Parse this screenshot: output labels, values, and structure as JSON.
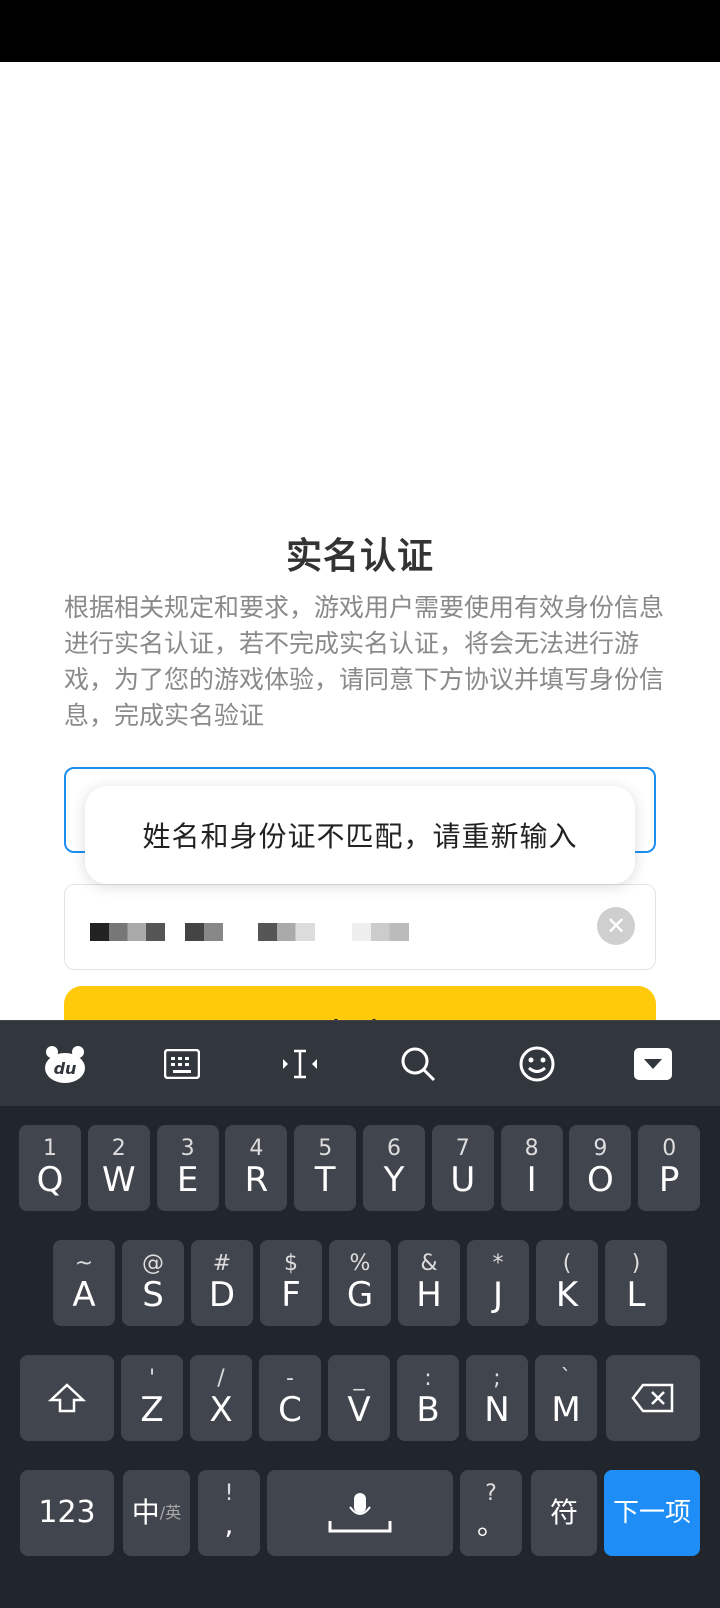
{
  "page": {
    "title": "实名认证",
    "description": "根据相关规定和要求，游戏用户需要使用有效身份信息进行实名认证，若不完成实名认证，将会无法进行游戏，为了您的游戏体验，请同意下方协议并填写身份信息，完成实名验证",
    "toast": "姓名和身份证不匹配，请重新输入",
    "submit_label": "提交"
  },
  "keyboard": {
    "toolbar_icons": [
      "du-logo-icon",
      "keyboard-icon",
      "cursor-icon",
      "search-icon",
      "emoji-icon",
      "collapse-icon"
    ],
    "row1": [
      {
        "sub": "1",
        "main": "Q"
      },
      {
        "sub": "2",
        "main": "W"
      },
      {
        "sub": "3",
        "main": "E"
      },
      {
        "sub": "4",
        "main": "R"
      },
      {
        "sub": "5",
        "main": "T"
      },
      {
        "sub": "6",
        "main": "Y"
      },
      {
        "sub": "7",
        "main": "U"
      },
      {
        "sub": "8",
        "main": "I"
      },
      {
        "sub": "9",
        "main": "O"
      },
      {
        "sub": "0",
        "main": "P"
      }
    ],
    "row2": [
      {
        "sub": "~",
        "main": "A"
      },
      {
        "sub": "@",
        "main": "S"
      },
      {
        "sub": "#",
        "main": "D"
      },
      {
        "sub": "$",
        "main": "F"
      },
      {
        "sub": "%",
        "main": "G"
      },
      {
        "sub": "&",
        "main": "H"
      },
      {
        "sub": "*",
        "main": "J"
      },
      {
        "sub": "(",
        "main": "K"
      },
      {
        "sub": ")",
        "main": "L"
      }
    ],
    "row3": [
      {
        "sub": "'",
        "main": "Z"
      },
      {
        "sub": "/",
        "main": "X"
      },
      {
        "sub": "-",
        "main": "C"
      },
      {
        "sub": "_",
        "main": "V"
      },
      {
        "sub": ":",
        "main": "B"
      },
      {
        "sub": ";",
        "main": "N"
      },
      {
        "sub": "`",
        "main": "M"
      }
    ],
    "shift": "⇧",
    "backspace": "⌫",
    "num_label": "123",
    "lang_label": "中",
    "lang_sub": "/英",
    "punct_top": "!",
    "punct_bottom": ",",
    "space_icon": "🎤",
    "period_top": "?",
    "period_bottom": "。",
    "symbol_label": "符",
    "next_label": "下一项"
  },
  "colors": {
    "accent": "#1e8ef6",
    "submit": "#ffca09"
  }
}
